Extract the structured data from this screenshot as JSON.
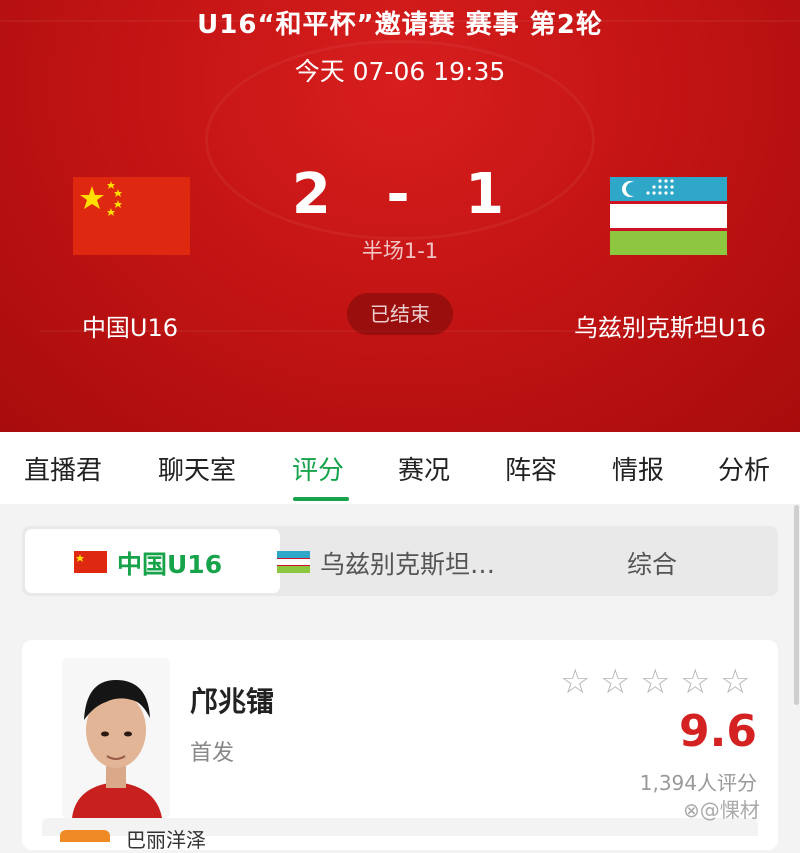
{
  "match": {
    "title": "U16“和平杯”邀请赛 赛事 第2轮",
    "time": "今天 07-06 19:35",
    "home_team": "中国U16",
    "away_team": "乌兹别克斯坦U16",
    "home_score": "2",
    "separator": "-",
    "away_score": "1",
    "half_time": "半场1-1",
    "status": "已结束"
  },
  "tabs": [
    {
      "label": "直播君"
    },
    {
      "label": "聊天室"
    },
    {
      "label": "评分",
      "active": true
    },
    {
      "label": "赛况"
    },
    {
      "label": "阵容"
    },
    {
      "label": "情报"
    },
    {
      "label": "分析"
    }
  ],
  "segment": {
    "home_label": "中国U16",
    "away_label": "乌兹别克斯坦…",
    "all_label": "综合",
    "selected": "home"
  },
  "player": {
    "name": "邝兆镭",
    "role": "首发",
    "rating": "9.6",
    "votes": "1,394人评分",
    "stars_filled": 0,
    "stars_total": 5
  },
  "next_row": {
    "text": "巴丽洋泽"
  },
  "watermark": "⊗@惈材",
  "colors": {
    "hero_red": "#c41414",
    "accent_green": "#16a34a",
    "rating_red": "#d42121",
    "flag_china": "#de2910",
    "flag_uz_blue": "#2ea7c9",
    "flag_uz_green": "#8dc63f"
  },
  "icons": {
    "star": "☆"
  }
}
